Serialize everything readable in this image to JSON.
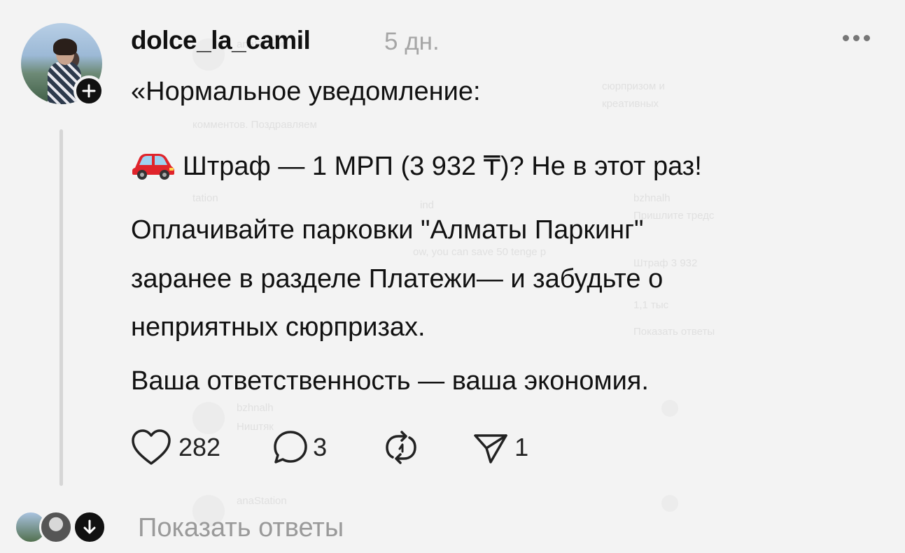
{
  "post": {
    "username": "dolce_la_camil",
    "time": "5 дн.",
    "text": {
      "line1": "«Нормальное уведомление:",
      "fine_line": "Штраф — 1 МРП (3 932 ₸)? Не в этот раз!",
      "paragraph_line1": "Оплачивайте парковки \"Алматы Паркинг\"",
      "paragraph_line2": "заранее в разделе Платежи— и забудьте о",
      "paragraph_line3": "неприятных сюрпризах.",
      "closing_line": "Ваша ответственность — ваша экономия."
    },
    "actions": {
      "like_count": "282",
      "comment_count": "3",
      "share_count": "1"
    },
    "show_replies": "Показать ответы"
  },
  "icons": {
    "more": "more-horizontal-icon",
    "follow": "plus-icon",
    "emoji": "red-car-emoji",
    "like": "heart-icon",
    "comment": "comment-bubble-icon",
    "repost": "repost-icon",
    "share": "send-icon",
    "reply_badge": "arrow-down-icon"
  },
  "colors": {
    "background": "#f3f3f3",
    "text": "#111111",
    "secondary_text": "#a6a6a6",
    "thread_line": "#d6d6d6"
  }
}
